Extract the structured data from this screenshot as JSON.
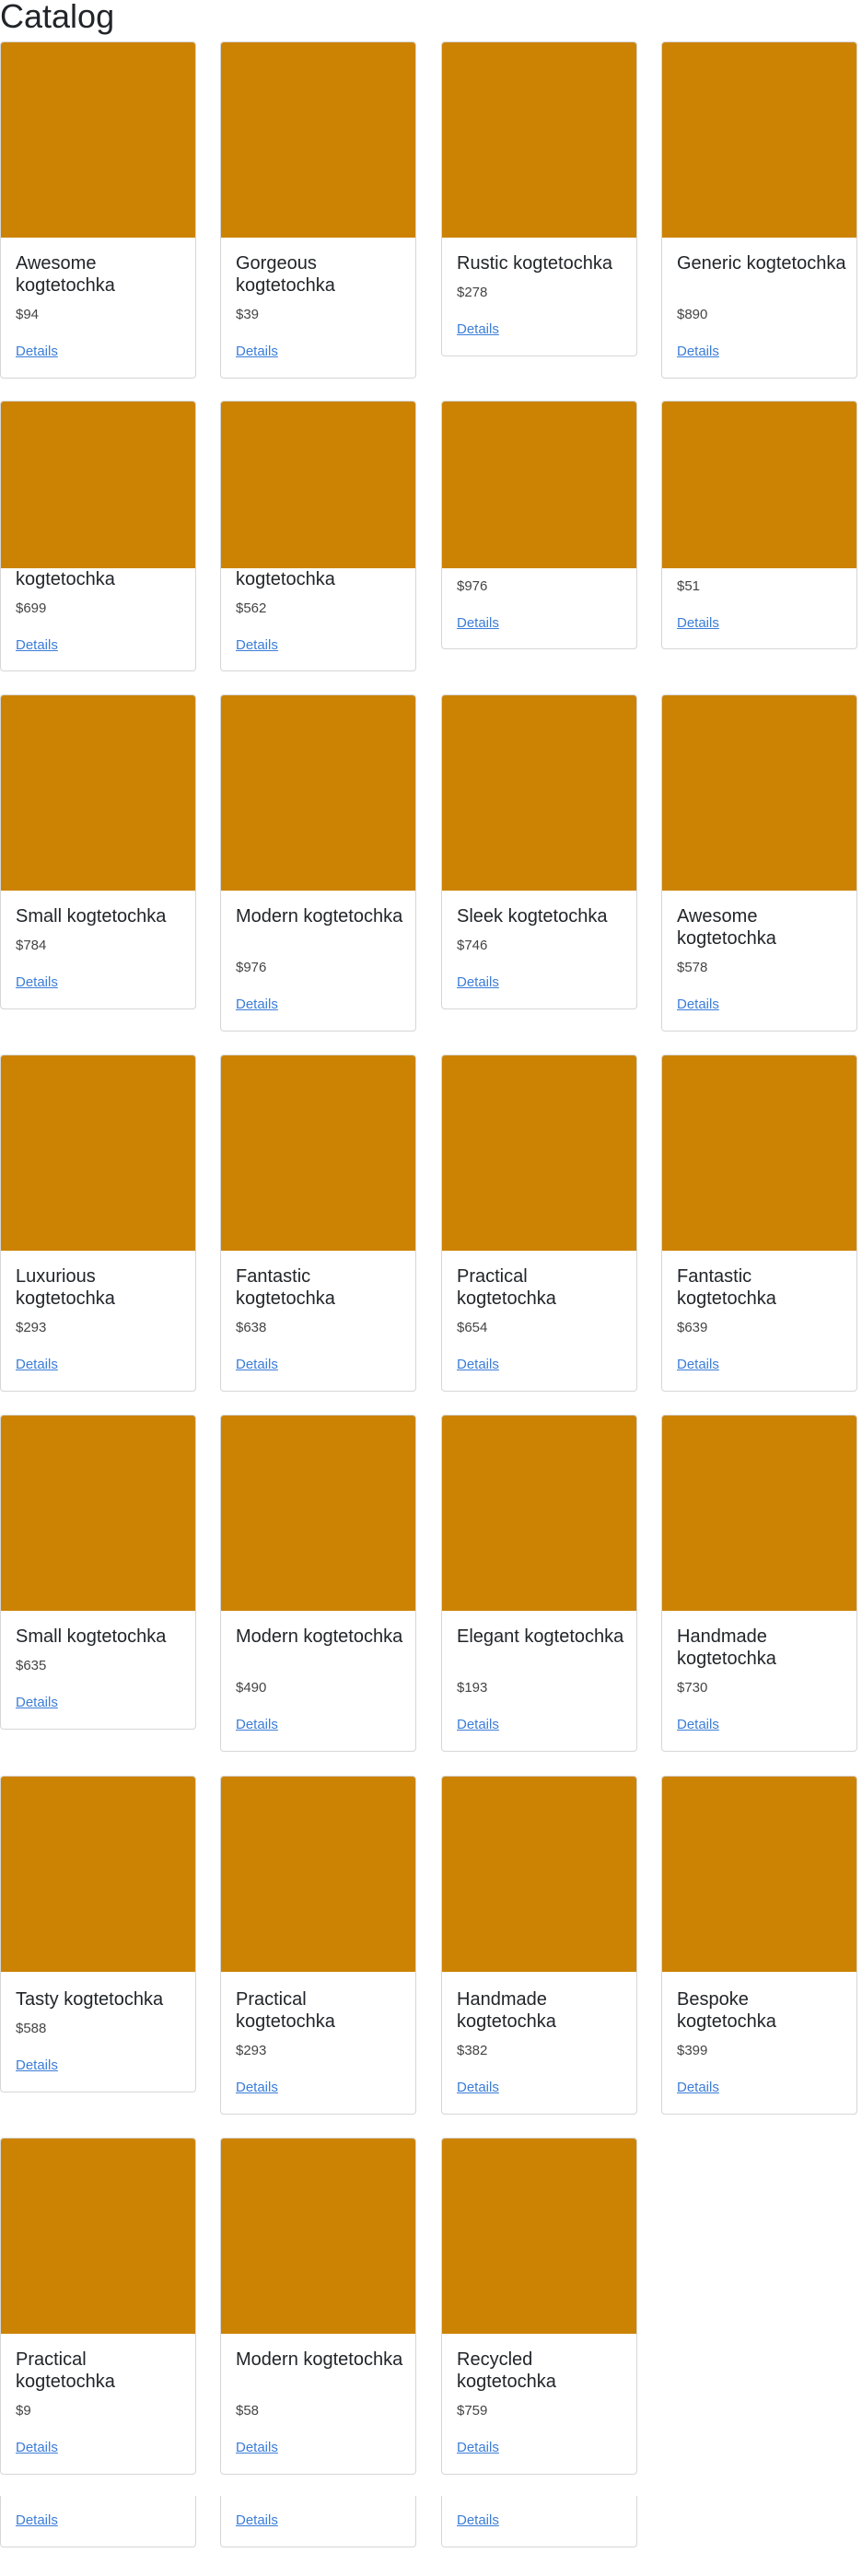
{
  "page": {
    "title": "Catalog"
  },
  "colors": {
    "image_placeholder": "#cc8303",
    "link": "#3b7dd8"
  },
  "products": [
    {
      "name": "Awesome kogtetochka",
      "price": "$94",
      "link": "Details"
    },
    {
      "name": "Gorgeous kogtetochka",
      "price": "$39",
      "link": "Details"
    },
    {
      "name": "Rustic kogtetochka",
      "price": "$278",
      "link": "Details"
    },
    {
      "name": "Generic kogtetochka",
      "price": "$890",
      "link": "Details"
    },
    {
      "name": "kogtetochka",
      "price": "$699",
      "link": "Details"
    },
    {
      "name": "kogtetochka",
      "price": "$562",
      "link": "Details"
    },
    {
      "name": "",
      "price": "$976",
      "link": "Details"
    },
    {
      "name": "",
      "price": "$51",
      "link": "Details"
    },
    {
      "name": "Small kogtetochka",
      "price": "$784",
      "link": "Details"
    },
    {
      "name": "Modern kogtetochka",
      "price": "$976",
      "link": "Details"
    },
    {
      "name": "Sleek kogtetochka",
      "price": "$746",
      "link": "Details"
    },
    {
      "name": "Awesome kogtetochka",
      "price": "$578",
      "link": "Details"
    },
    {
      "name": "Luxurious kogtetochka",
      "price": "$293",
      "link": "Details"
    },
    {
      "name": "Fantastic kogtetochka",
      "price": "$638",
      "link": "Details"
    },
    {
      "name": "Practical kogtetochka",
      "price": "$654",
      "link": "Details"
    },
    {
      "name": "Fantastic kogtetochka",
      "price": "$639",
      "link": "Details"
    },
    {
      "name": "Small kogtetochka",
      "price": "$635",
      "link": "Details"
    },
    {
      "name": "Modern kogtetochka",
      "price": "$490",
      "link": "Details"
    },
    {
      "name": "Elegant kogtetochka",
      "price": "$193",
      "link": "Details"
    },
    {
      "name": "Handmade kogtetochka",
      "price": "$730",
      "link": "Details"
    },
    {
      "name": "Tasty kogtetochka",
      "price": "$588",
      "link": "Details"
    },
    {
      "name": "Practical kogtetochka",
      "price": "$293",
      "link": "Details"
    },
    {
      "name": "Handmade kogtetochka",
      "price": "$382",
      "link": "Details"
    },
    {
      "name": "Bespoke kogtetochka",
      "price": "$399",
      "link": "Details"
    },
    {
      "name": "Practical kogtetochka",
      "price": "$9",
      "link": "Details"
    },
    {
      "name": "Modern kogtetochka",
      "price": "$58",
      "link": "Details"
    },
    {
      "name": "Recycled kogtetochka",
      "price": "$759",
      "link": "Details"
    },
    {
      "name": "",
      "price": "",
      "link": "Details"
    },
    {
      "name": "",
      "price": "",
      "link": "Details"
    },
    {
      "name": "",
      "price": "",
      "link": "Details"
    }
  ]
}
